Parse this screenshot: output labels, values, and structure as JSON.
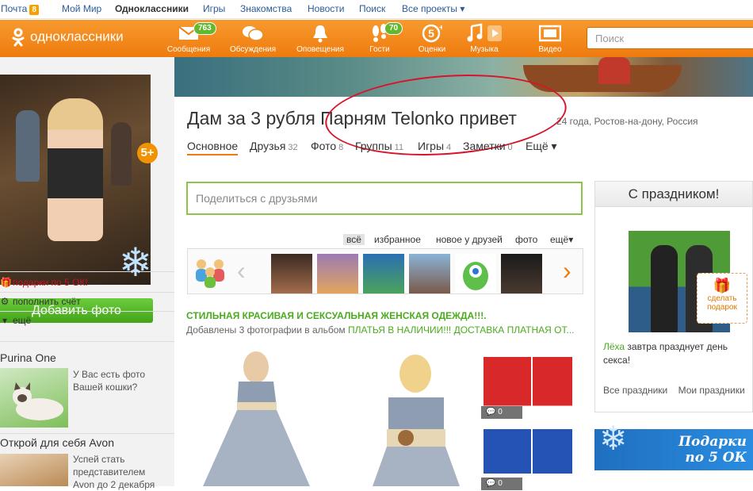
{
  "portal": {
    "mail": "Почта",
    "mail_count": "8",
    "moimir": "Мой Мир",
    "ok": "Одноклассники",
    "games": "Игры",
    "dating": "Знакомства",
    "news": "Новости",
    "search": "Поиск",
    "all_projects": "Все проекты ▾"
  },
  "toolbar": {
    "logo": "одноклассники",
    "items": [
      {
        "label": "Сообщения",
        "badge": "763",
        "icon": "envelope-icon"
      },
      {
        "label": "Обсуждения",
        "badge": "",
        "icon": "chat-bubbles-icon"
      },
      {
        "label": "Оповещения",
        "badge": "",
        "icon": "bell-icon"
      },
      {
        "label": "Гости",
        "badge": "70",
        "icon": "footprints-icon"
      },
      {
        "label": "Оценки",
        "badge": "",
        "icon": "rating-5-icon"
      },
      {
        "label": "Музыка",
        "badge": "",
        "icon": "music-note-icon"
      },
      {
        "label": "Видео",
        "badge": "",
        "icon": "video-icon"
      }
    ],
    "search_placeholder": "Поиск"
  },
  "left": {
    "badge5": "5+",
    "add_photo": "Добавить фото",
    "menu": [
      "подарки по 5 ОК!",
      "пополнить счёт",
      "ещё"
    ],
    "ads": [
      {
        "title": "Purina One",
        "text": "У Вас есть фото Вашей кошки?"
      },
      {
        "title": "Открой для себя Avon",
        "text": "Успей стать представителем Avon до 2 декабря"
      }
    ]
  },
  "profile": {
    "name": "Дам за 3 рубля Парням Telonko привет",
    "info": "24 года, Ростов-на-дону, Россия",
    "tabs": [
      {
        "label": "Основное",
        "count": ""
      },
      {
        "label": "Друзья",
        "count": "32"
      },
      {
        "label": "Фото",
        "count": "8"
      },
      {
        "label": "Группы",
        "count": "11"
      },
      {
        "label": "Игры",
        "count": "4"
      },
      {
        "label": "Заметки",
        "count": "0"
      },
      {
        "label": "Ещё ▾",
        "count": ""
      }
    ]
  },
  "share": {
    "placeholder": "Поделиться с друзьями"
  },
  "feed": {
    "filters": [
      "всё",
      "избранное",
      "новое у друзей",
      "фото",
      "ещё▾"
    ],
    "post_title": "СТИЛЬНАЯ КРАСИВАЯ И СЕКСУАЛЬНАЯ ЖЕНСКАЯ ОДЕЖДА!!!.",
    "post_sub": "Добавлены 3 фотографии в альбом ",
    "post_album": "ПЛАТЬЯ В НАЛИЧИИ!!! ДОСТАВКА ПЛАТНАЯ ОТ...",
    "comments": [
      "0",
      "0"
    ]
  },
  "holidays": {
    "title": "С праздником!",
    "gift": "сделать подарок",
    "name": "Лёха",
    "text": " завтра празднует день секса!",
    "all": "Все праздники",
    "mine": "Мои праздники"
  },
  "promo": {
    "line1": "Подарки",
    "line2": "по 5 ОК"
  }
}
